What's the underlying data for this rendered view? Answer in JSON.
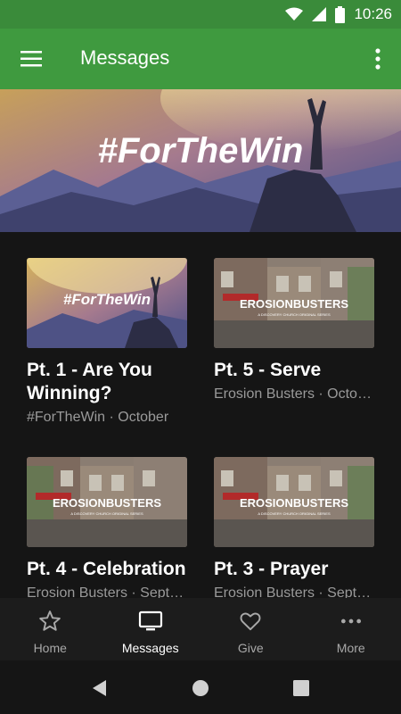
{
  "status_bar": {
    "time": "10:26"
  },
  "app_bar": {
    "title": "Messages"
  },
  "hero": {
    "text": "#ForTheWin"
  },
  "cards": [
    {
      "title": "Pt. 1 - Are You Winning?",
      "subtitle": "#ForTheWin · October",
      "thumb": "forthewin",
      "thumb_text": "#ForTheWin"
    },
    {
      "title": "Pt. 5 - Serve",
      "subtitle": "Erosion Busters · October",
      "thumb": "erosion",
      "thumb_text": "EROSIONBUSTERS",
      "thumb_subtext": "A DISCOVERY CHURCH ORIGINAL SERIES"
    },
    {
      "title": "Pt. 4 - Celebration",
      "subtitle": "Erosion Busters · September",
      "thumb": "erosion",
      "thumb_text": "EROSIONBUSTERS",
      "thumb_subtext": "A DISCOVERY CHURCH ORIGINAL SERIES"
    },
    {
      "title": "Pt. 3 - Prayer",
      "subtitle": "Erosion Busters · September",
      "thumb": "erosion",
      "thumb_text": "EROSIONBUSTERS",
      "thumb_subtext": "A DISCOVERY CHURCH ORIGINAL SERIES"
    }
  ],
  "bottom_nav": [
    {
      "label": "Home",
      "icon": "star-icon",
      "active": false
    },
    {
      "label": "Messages",
      "icon": "tv-icon",
      "active": true
    },
    {
      "label": "Give",
      "icon": "heart-icon",
      "active": false
    },
    {
      "label": "More",
      "icon": "more-horizontal-icon",
      "active": false
    }
  ],
  "colors": {
    "status_bar": "#3a8b3a",
    "app_bar": "#3f9a3f",
    "background": "#151515",
    "nav_bar": "#1c1c1c"
  }
}
